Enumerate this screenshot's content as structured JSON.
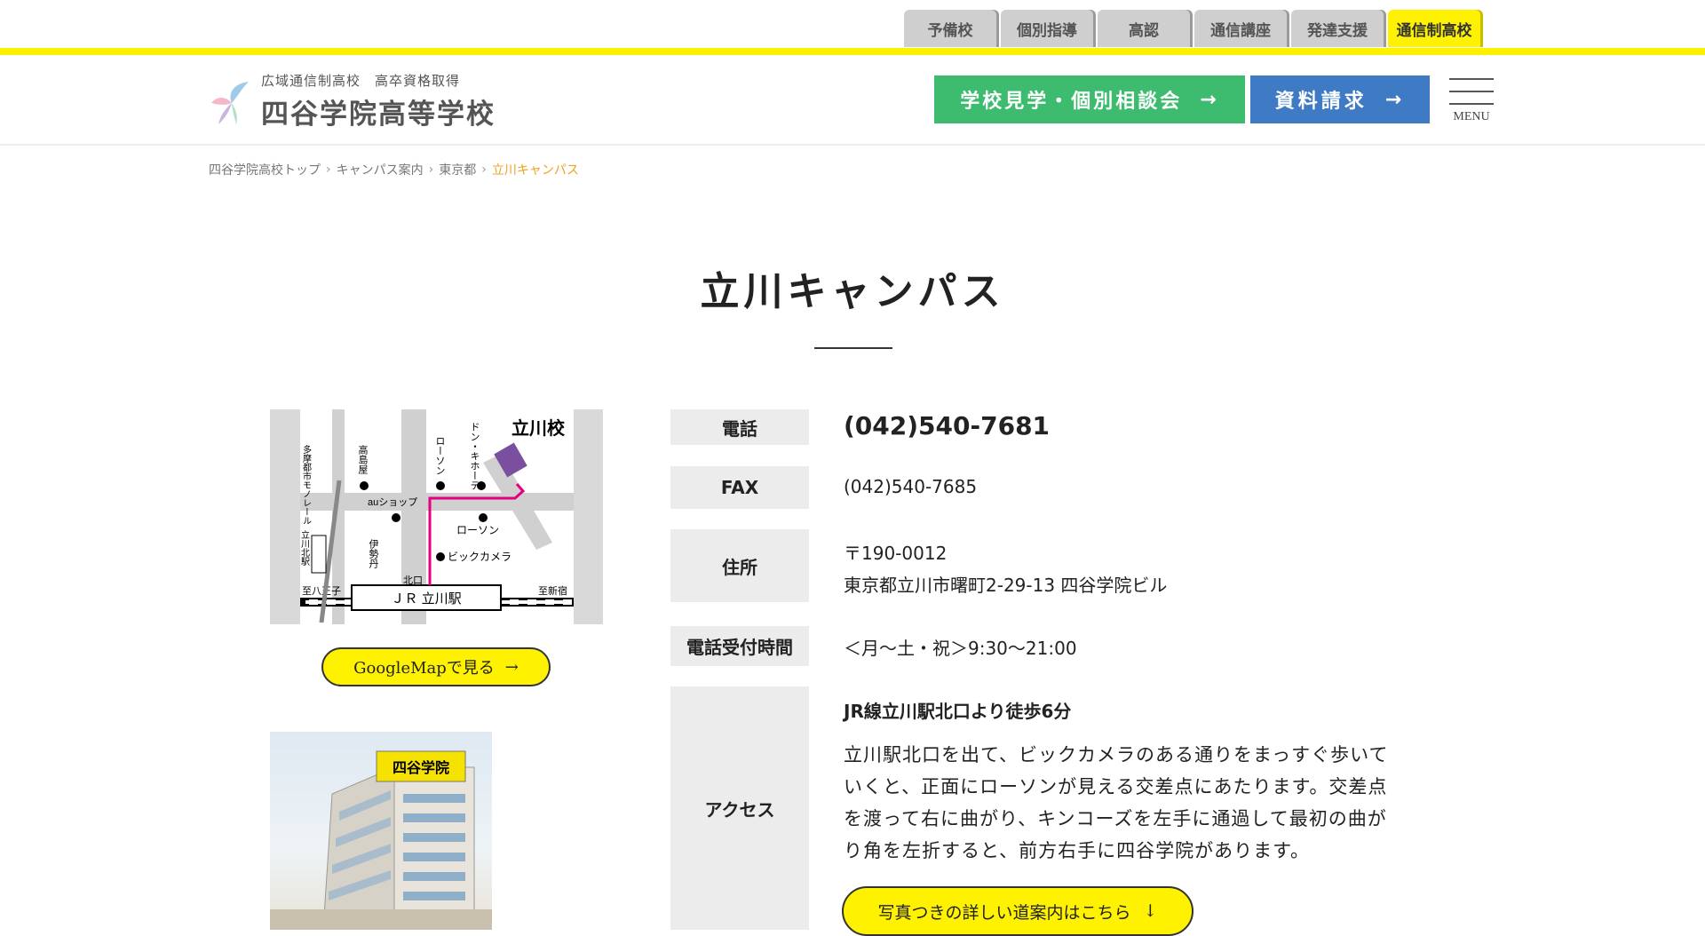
{
  "top_tabs": [
    "予備校",
    "個別指導",
    "高認",
    "通信講座",
    "発達支援",
    "通信制高校"
  ],
  "active_tab": "通信制高校",
  "logo": {
    "subtitle": "広域通信制高校　高卒資格取得",
    "name": "四谷学院高等学校"
  },
  "header": {
    "visit_label": "学校見学・個別相談会",
    "docs_label": "資料請求",
    "arrow": "→",
    "menu_label": "MENU"
  },
  "breadcrumb": [
    "四谷学院高校トップ",
    "キャンパス案内",
    "東京都",
    "立川キャンパス"
  ],
  "page_title": "立川キャンパス",
  "map": {
    "school_label": "立川校",
    "monorail": "多摩都市モノレール",
    "takashimaya": "高島屋",
    "lawson1": "ローソン",
    "donki": "ドン・キホーテ",
    "au": "auショップ",
    "lawson2": "ローソン",
    "tachikawa_kita": "立川北駅",
    "isetan": "伊勢丹",
    "bic": "ビックカメラ",
    "kitaguchi": "北口",
    "hachioji": "至八王子",
    "shinjuku": "至新宿",
    "station": "ＪＲ 立川駅"
  },
  "googlemap_label": "GoogleMapで見る",
  "building_sign": "四谷学院",
  "info": {
    "tel_label": "電話",
    "tel": "(042)540-7681",
    "fax_label": "FAX",
    "fax": "(042)540-7685",
    "addr_label": "住所",
    "zip": "〒190-0012",
    "addr": "東京都立川市曙町2-29-13 四谷学院ビル",
    "hours_label": "電話受付時間",
    "hours": "＜月〜土・祝＞9:30〜21:00",
    "access_label": "アクセス",
    "access_head": "JR線立川駅北口より徒歩6分",
    "access_body": "立川駅北口を出て、ビックカメラのある通りをまっすぐ歩いていくと、正面にローソンが見える交差点にあたります。交差点を渡って右に曲がり、キンコーズを左手に通過して最初の曲がり角を左折すると、前方右手に四谷学院があります。",
    "route_label": "写真つきの詳しい道案内はこちら",
    "route_arrow": "↓"
  },
  "colors": {
    "yellow": "#fff200",
    "green": "#3dbb6e",
    "blue": "#3f7bc4",
    "route": "#e4007f",
    "school": "#7b4fa0"
  }
}
